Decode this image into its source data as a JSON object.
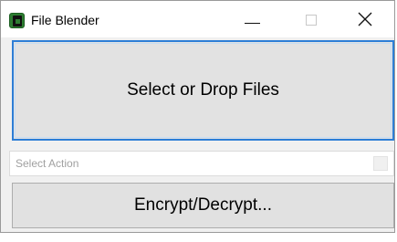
{
  "window": {
    "title": "File Blender",
    "controls": {
      "minimize": "minimize-icon",
      "maximize": "maximize-icon",
      "close": "close-icon"
    }
  },
  "main": {
    "drop_label": "Select or Drop Files",
    "select_placeholder": "Select Action",
    "action_button_label": "Encrypt/Decrypt..."
  },
  "colors": {
    "drop_border": "#2d7ed6",
    "app_icon": "#2e7d32"
  }
}
